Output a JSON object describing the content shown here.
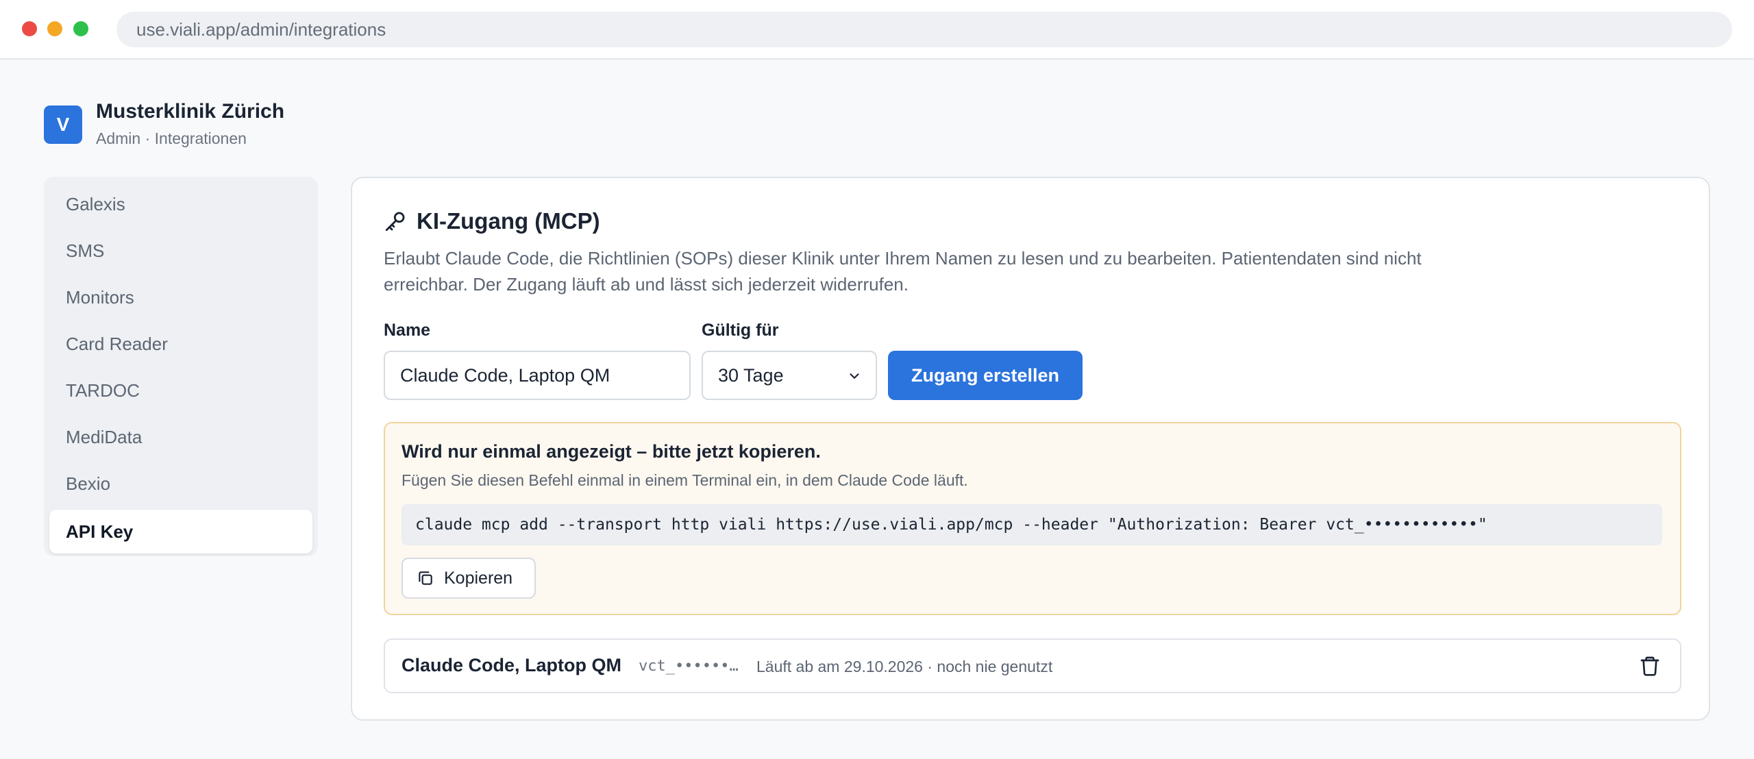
{
  "browser": {
    "url": "use.viali.app/admin/integrations"
  },
  "brand": {
    "logo_letter": "V",
    "name": "Musterklinik Zürich",
    "subtitle": "Admin · Integrationen"
  },
  "sidebar": {
    "items": [
      {
        "label": "Galexis",
        "active": false
      },
      {
        "label": "SMS",
        "active": false
      },
      {
        "label": "Monitors",
        "active": false
      },
      {
        "label": "Card Reader",
        "active": false
      },
      {
        "label": "TARDOC",
        "active": false
      },
      {
        "label": "MediData",
        "active": false
      },
      {
        "label": "Bexio",
        "active": false
      },
      {
        "label": "API Key",
        "active": true
      }
    ]
  },
  "main": {
    "title": "KI-Zugang (MCP)",
    "title_icon": "key-icon",
    "description": "Erlaubt Claude Code, die Richtlinien (SOPs) dieser Klinik unter Ihrem Namen zu lesen und zu bearbeiten. Patientendaten sind nicht erreichbar. Der Zugang läuft ab und lässt sich jederzeit widerrufen.",
    "form": {
      "name_label": "Name",
      "name_value": "Claude Code, Laptop QM",
      "validity_label": "Gültig für",
      "validity_value": "30 Tage",
      "create_button": "Zugang erstellen"
    },
    "notice": {
      "title": "Wird nur einmal angezeigt – bitte jetzt kopieren.",
      "subtitle": "Fügen Sie diesen Befehl einmal in einem Terminal ein, in dem Claude Code läuft.",
      "command": "claude mcp add --transport http viali https://use.viali.app/mcp --header \"Authorization: Bearer vct_••••••••••••\"",
      "copy_button": "Kopieren"
    },
    "token": {
      "name": "Claude Code, Laptop QM",
      "masked_key": "vct_••••••…",
      "meta": "Läuft ab am 29.10.2026 · noch nie genutzt"
    }
  },
  "colors": {
    "accent": "#2b73dd",
    "notice_bg": "#fdf8f0",
    "notice_border": "#f1d49d"
  }
}
